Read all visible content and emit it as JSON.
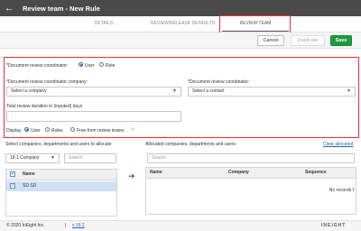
{
  "header": {
    "back_icon": "left-arrow-icon",
    "title": "Review team - New Rule"
  },
  "tabs": [
    {
      "label": "DETAILS",
      "active": false
    },
    {
      "label": "REVIEW/RELEASE DEFAULTS",
      "active": false
    },
    {
      "label": "REVIEW TEAM",
      "active": true
    }
  ],
  "actions": {
    "cancel": "Cancel",
    "duplicate": "Duplicate",
    "save": "Save"
  },
  "form": {
    "coordinator_label": "*Document review coordinator:",
    "coordinator_type": {
      "options": [
        "User",
        "Role"
      ],
      "selected": "User"
    },
    "company_label": "*Document review coordinator company:",
    "company_value": "Select a company",
    "contact_label": "*Document review coordinator:",
    "contact_value": "Select a contact",
    "duration_label": "Total review duration in (inputed) days",
    "duration_value": "",
    "display_label": "Display",
    "display_options": [
      "User",
      "Roles",
      "Free form review teams"
    ],
    "display_selected": "User"
  },
  "left_panel": {
    "title": "Select companies, departments and users to allocate",
    "company_select": "18.1 Company",
    "search_placeholder": "Search",
    "header_name": "Name",
    "rows": [
      {
        "name": "SD SD",
        "checked": true
      }
    ]
  },
  "right_panel": {
    "title": "Allocated companies, departments and users",
    "clear_link": "Clear allocated",
    "search_placeholder": "Search",
    "columns": [
      "Name",
      "Company",
      "Sequence"
    ],
    "empty_text": "No records f"
  },
  "footer": {
    "copyright": "© 2020 InEight Inc.",
    "separator": "|",
    "version": "v 19.2",
    "logo": "INEIGHT"
  },
  "colors": {
    "header_bg": "#4a4a4a",
    "save_green": "#1c9a3d",
    "highlight_red": "#e8322d",
    "selection_blue": "#cfe1f5"
  }
}
